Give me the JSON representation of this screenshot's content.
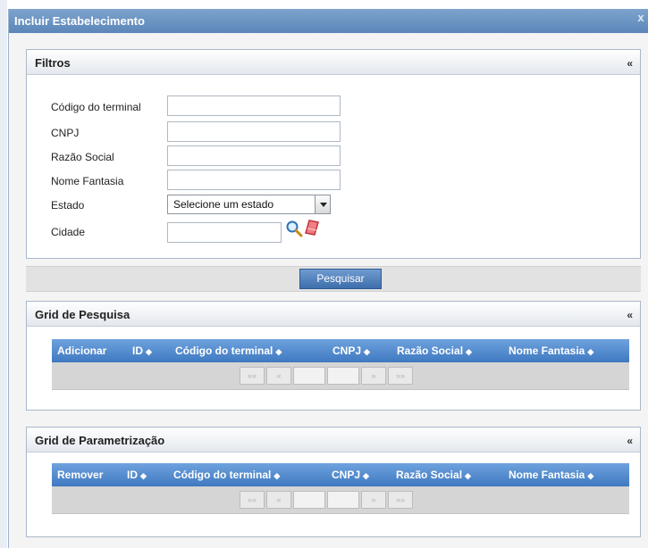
{
  "dialog": {
    "title": "Incluir Estabelecimento",
    "close": "x"
  },
  "filters": {
    "title": "Filtros",
    "collapse": "«",
    "fields": [
      {
        "label": "Código do terminal",
        "value": ""
      },
      {
        "label": "CNPJ",
        "value": ""
      },
      {
        "label": "Razão Social",
        "value": ""
      },
      {
        "label": "Nome Fantasia",
        "value": ""
      }
    ],
    "state": {
      "label": "Estado",
      "selected": "Selecione um estado"
    },
    "city": {
      "label": "Cidade",
      "value": "",
      "search_icon": "magnifier-icon",
      "clear_icon": "eraser-icon"
    }
  },
  "search_button": "Pesquisar",
  "grid_search": {
    "title": "Grid de Pesquisa",
    "collapse": "«",
    "columns": [
      "Adicionar",
      "ID",
      "Código do terminal",
      "CNPJ",
      "Razão Social",
      "Nome Fantasia"
    ],
    "sort_icon": "⬘",
    "pager": [
      "««",
      "«",
      "",
      "",
      "»",
      "»»"
    ]
  },
  "grid_param": {
    "title": "Grid de Parametrização",
    "collapse": "«",
    "columns": [
      "Remover",
      "ID",
      "Código do terminal",
      "CNPJ",
      "Razão Social",
      "Nome Fantasia"
    ],
    "pager": [
      "««",
      "«",
      "",
      "",
      "»",
      "»»"
    ]
  },
  "colors": {
    "title_bar": "#5b86b8",
    "grid_header": "#4f8ad0",
    "button": "#4f80bd"
  }
}
